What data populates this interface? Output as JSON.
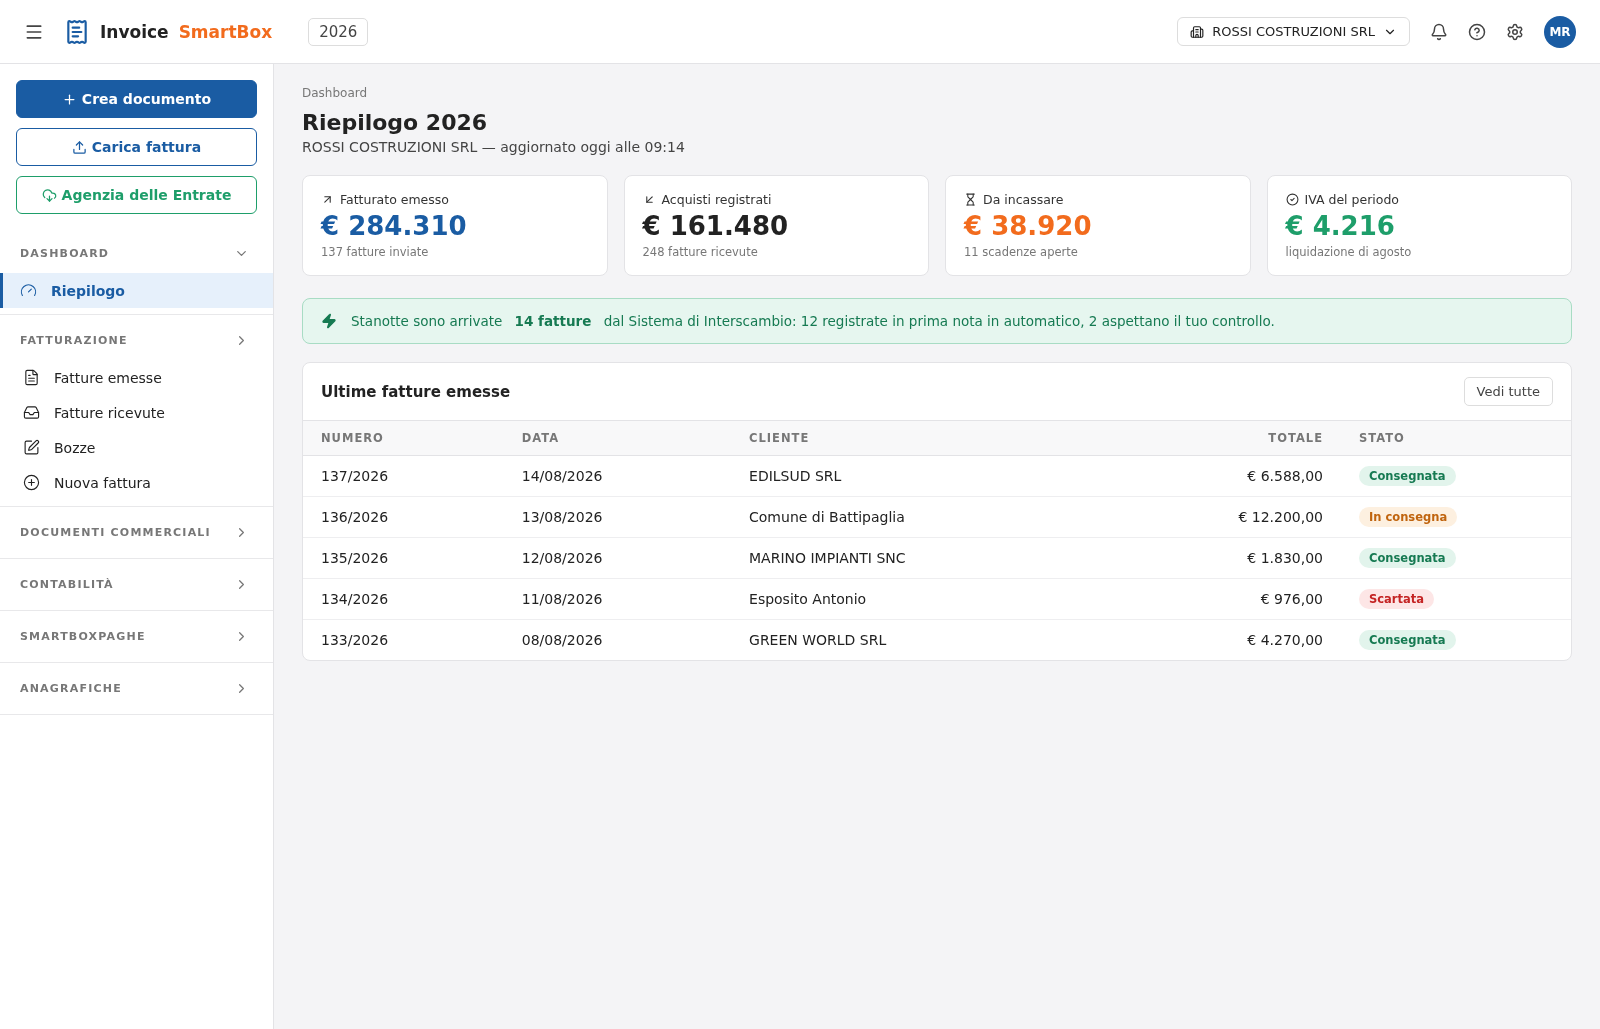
{
  "header": {
    "brand_first": "Invoice",
    "brand_second": "SmartBox",
    "year": "2026",
    "company": "ROSSI COSTRUZIONI SRL",
    "avatar": "MR"
  },
  "sidebar": {
    "actions": [
      {
        "label": "Crea documento",
        "kind": "primary"
      },
      {
        "label": "Carica fattura",
        "kind": "outline"
      },
      {
        "label": "Agenzia delle Entrate",
        "kind": "success"
      }
    ],
    "sections": [
      {
        "title": "DASHBOARD",
        "expanded": true,
        "items": [
          {
            "label": "Riepilogo",
            "kind": "gauge",
            "selected": true
          }
        ]
      },
      {
        "title": "FATTURAZIONE",
        "expanded": false,
        "items": [
          {
            "label": "Fatture emesse",
            "kind": "file",
            "selected": false
          },
          {
            "label": "Fatture ricevute",
            "kind": "inbox",
            "selected": false
          },
          {
            "label": "Bozze",
            "kind": "edit",
            "selected": false
          },
          {
            "label": "Nuova fattura",
            "kind": "plus",
            "selected": false
          }
        ]
      },
      {
        "title": "DOCUMENTI COMMERCIALI",
        "expanded": false
      },
      {
        "title": "CONTABILITÀ",
        "expanded": false
      },
      {
        "title": "SMARTBOXPAGHE",
        "expanded": false
      },
      {
        "title": "ANAGRAFICHE",
        "expanded": false
      }
    ]
  },
  "breadcrumb": "Dashboard",
  "title": "Riepilogo 2026",
  "subtitle": "ROSSI COSTRUZIONI SRL — aggiornato oggi alle 09:14",
  "kpis": [
    {
      "label": "Fatturato emesso",
      "kind": "up",
      "value": "€ 284.310",
      "note": "137 fatture inviate",
      "color": "#1a5ca3"
    },
    {
      "label": "Acquisti registrati",
      "kind": "down",
      "value": "€ 161.480",
      "note": "248 fatture ricevute",
      "color": "#222222"
    },
    {
      "label": "Da incassare",
      "kind": "hourglass",
      "value": "€ 38.920",
      "note": "11 scadenze aperte",
      "color": "#f26b1d"
    },
    {
      "label": "IVA del periodo",
      "kind": "check",
      "value": "€ 4.216",
      "note": "liquidazione di agosto",
      "color": "#1e9e6a"
    }
  ],
  "alert": "Stanotte sono arrivate **14 fatture** dal Sistema di Interscambio: 12 registrate in prima nota in automatico, 2 aspettano il tuo controllo.",
  "table": {
    "title": "Ultime fatture emesse",
    "button": "Vedi tutte",
    "columns": [
      "NUMERO",
      "DATA",
      "CLIENTE",
      "TOTALE",
      "STATO"
    ],
    "rows": [
      {
        "numero": "137/2026",
        "data": "14/08/2026",
        "cliente": "EDILSUD SRL",
        "totale": "€ 6.588,00",
        "stato": "Consegnata",
        "kind": "delivered"
      },
      {
        "numero": "136/2026",
        "data": "13/08/2026",
        "cliente": "Comune di Battipaglia",
        "totale": "€ 12.200,00",
        "stato": "In consegna",
        "kind": "pending"
      },
      {
        "numero": "135/2026",
        "data": "12/08/2026",
        "cliente": "MARINO IMPIANTI SNC",
        "totale": "€ 1.830,00",
        "stato": "Consegnata",
        "kind": "delivered"
      },
      {
        "numero": "134/2026",
        "data": "11/08/2026",
        "cliente": "Esposito Antonio",
        "totale": "€ 976,00",
        "stato": "Scartata",
        "kind": "rejected"
      },
      {
        "numero": "133/2026",
        "data": "08/08/2026",
        "cliente": "GREEN WORLD SRL",
        "totale": "€ 4.270,00",
        "stato": "Consegnata",
        "kind": "delivered"
      }
    ]
  }
}
